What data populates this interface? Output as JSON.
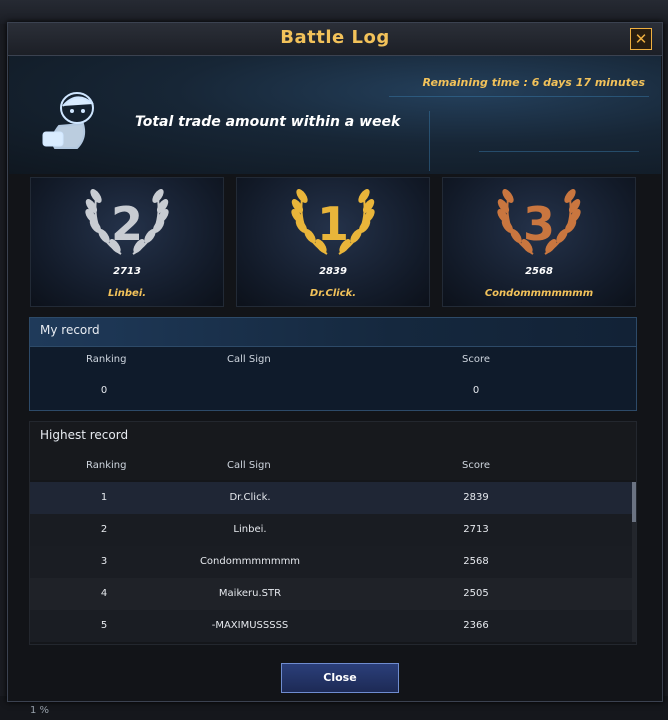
{
  "window": {
    "title": "Battle Log",
    "close_icon": "close-icon"
  },
  "hero": {
    "remaining_time": "Remaining time : 6 days 17 minutes",
    "description": "Total trade amount within a week",
    "mascot_icon": "mascot-icon"
  },
  "podium": [
    {
      "rank": "2",
      "score": "2713",
      "name": "Linbei.",
      "color": "#c8ccd2"
    },
    {
      "rank": "1",
      "score": "2839",
      "name": "Dr.Click.",
      "color": "#e9b53a"
    },
    {
      "rank": "3",
      "score": "2568",
      "name": "Condommmmmmm",
      "color": "#c9763f"
    }
  ],
  "my_record": {
    "title": "My record",
    "headers": {
      "ranking": "Ranking",
      "call_sign": "Call Sign",
      "score": "Score"
    },
    "ranking": "0",
    "call_sign": "",
    "score": "0"
  },
  "highest_record": {
    "title": "Highest record",
    "headers": {
      "ranking": "Ranking",
      "call_sign": "Call Sign",
      "score": "Score"
    },
    "rows": [
      {
        "ranking": "1",
        "call_sign": "Dr.Click.",
        "score": "2839"
      },
      {
        "ranking": "2",
        "call_sign": "Linbei.",
        "score": "2713"
      },
      {
        "ranking": "3",
        "call_sign": "Condommmmmmm",
        "score": "2568"
      },
      {
        "ranking": "4",
        "call_sign": "Maikeru.STR",
        "score": "2505"
      },
      {
        "ranking": "5",
        "call_sign": "-MAXIMUSSSSS",
        "score": "2366"
      }
    ]
  },
  "footer": {
    "close_label": "Close"
  },
  "background": {
    "percent": "1 %"
  }
}
